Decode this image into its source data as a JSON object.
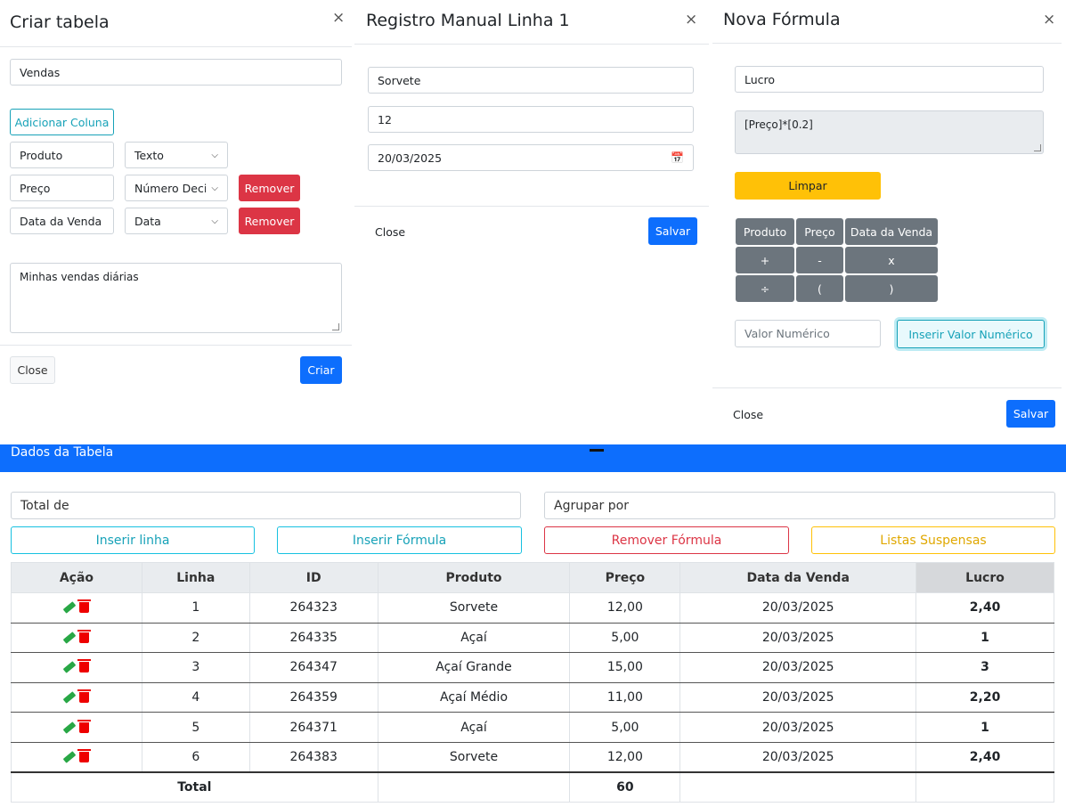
{
  "criar": {
    "title": "Criar tabela",
    "table_name": "Vendas",
    "add_column": "Adicionar Coluna",
    "columns": [
      {
        "name": "Produto",
        "type": "Texto"
      },
      {
        "name": "Preço",
        "type": "Número Decimal",
        "remove": "Remover"
      },
      {
        "name": "Data da Venda",
        "type": "Data",
        "remove": "Remover"
      }
    ],
    "description": "Minhas vendas diárias",
    "close": "Close",
    "submit": "Criar"
  },
  "registro": {
    "title": "Registro Manual Linha 1",
    "fields": [
      "Sorvete",
      "12",
      "20/03/2025"
    ],
    "close": "Close",
    "save": "Salvar"
  },
  "formula": {
    "title": "Nova Fórmula",
    "name": "Lucro",
    "expression": "[Preço]*[0.2]",
    "clear": "Limpar",
    "keys": [
      [
        "Produto",
        "Preço",
        "Data da Venda"
      ],
      [
        "+",
        "-",
        "x"
      ],
      [
        "÷",
        "(",
        ")"
      ]
    ],
    "numeric_placeholder": "Valor Numérico",
    "insert_numeric": "Inserir Valor Numérico",
    "close": "Close",
    "save": "Salvar"
  },
  "dados": {
    "title": "Dados da Tabela",
    "collapse": "—",
    "total_placeholder": "Total de",
    "group_placeholder": "Agrupar por",
    "buttons": {
      "insert_row": "Inserir linha",
      "insert_formula": "Inserir Fórmula",
      "remove_formula": "Remover Fórmula",
      "dropdowns": "Listas Suspensas"
    },
    "headers": [
      "Ação",
      "Linha",
      "ID",
      "Produto",
      "Preço",
      "Data da Venda",
      "Lucro"
    ],
    "rows": [
      [
        "1",
        "264323",
        "Sorvete",
        "12,00",
        "20/03/2025",
        "2,40"
      ],
      [
        "2",
        "264335",
        "Açaí",
        "5,00",
        "20/03/2025",
        "1"
      ],
      [
        "3",
        "264347",
        "Açaí Grande",
        "15,00",
        "20/03/2025",
        "3"
      ],
      [
        "4",
        "264359",
        "Açaí Médio",
        "11,00",
        "20/03/2025",
        "2,20"
      ],
      [
        "5",
        "264371",
        "Açaí",
        "5,00",
        "20/03/2025",
        "1"
      ],
      [
        "6",
        "264383",
        "Sorvete",
        "12,00",
        "20/03/2025",
        "2,40"
      ]
    ],
    "total_label": "Total",
    "total_value": "60"
  },
  "colors": {
    "primary": "#0d6efd",
    "danger": "#dc3545",
    "warning": "#ffc107",
    "info": "#17a2b8",
    "secondary": "#6c757d"
  }
}
